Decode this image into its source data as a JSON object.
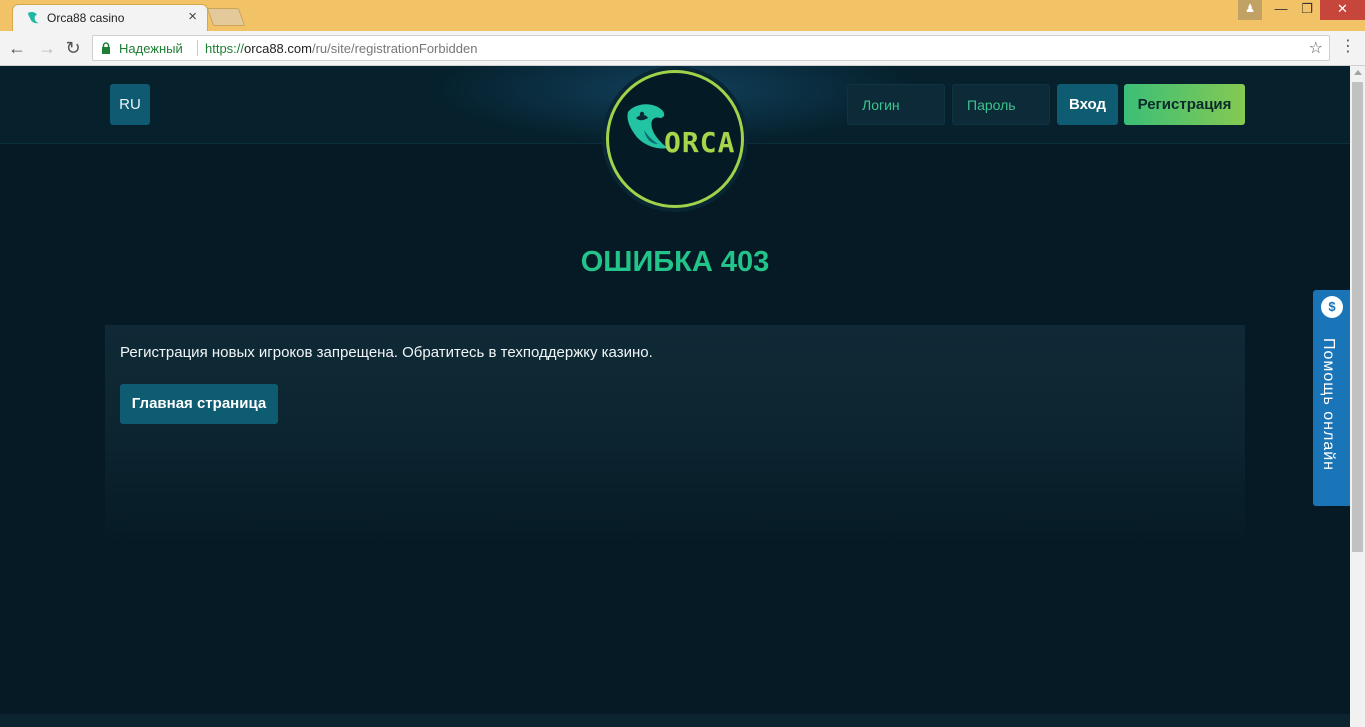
{
  "browser": {
    "tab_title": "Orca88 casino",
    "tab_close": "×",
    "window_buttons": {
      "user": "♟",
      "minimize": "—",
      "maximize": "❐",
      "close": "✕"
    },
    "secure_label": "Надежный",
    "url_scheme": "https://",
    "url_host": "orca88.com",
    "url_path": "/ru/site/registrationForbidden",
    "star": "☆",
    "menu": "⋮",
    "nav": {
      "back": "←",
      "forward": "→",
      "reload": "↻"
    }
  },
  "header": {
    "lang": "RU",
    "login_placeholder": "Логин",
    "password_placeholder": "Пароль",
    "enter_label": "Вход",
    "register_label": "Регистрация",
    "logo_text": "ORCA"
  },
  "main": {
    "error_title": "ОШИБКА 403",
    "message": "Регистрация новых игроков запрещена. Обратитесь в техподдержку казино.",
    "home_button": "Главная страница"
  },
  "help_widget": {
    "icon_symbol": "$",
    "label": "Помощь онлайн"
  },
  "colors": {
    "accent_green": "#22c48a",
    "button_teal": "#0e5c72",
    "register_gradient_start": "#3bbf78",
    "register_gradient_end": "#85c951",
    "page_bg": "#051a24",
    "help_blue": "#1a74b8",
    "tabbar": "#f2c366"
  },
  "icons": [
    "orca-favicon-icon",
    "lock-icon",
    "star-icon",
    "menu-icon",
    "back-arrow-icon",
    "forward-arrow-icon",
    "reload-icon",
    "chat-dollar-icon",
    "orca-logo-icon"
  ]
}
